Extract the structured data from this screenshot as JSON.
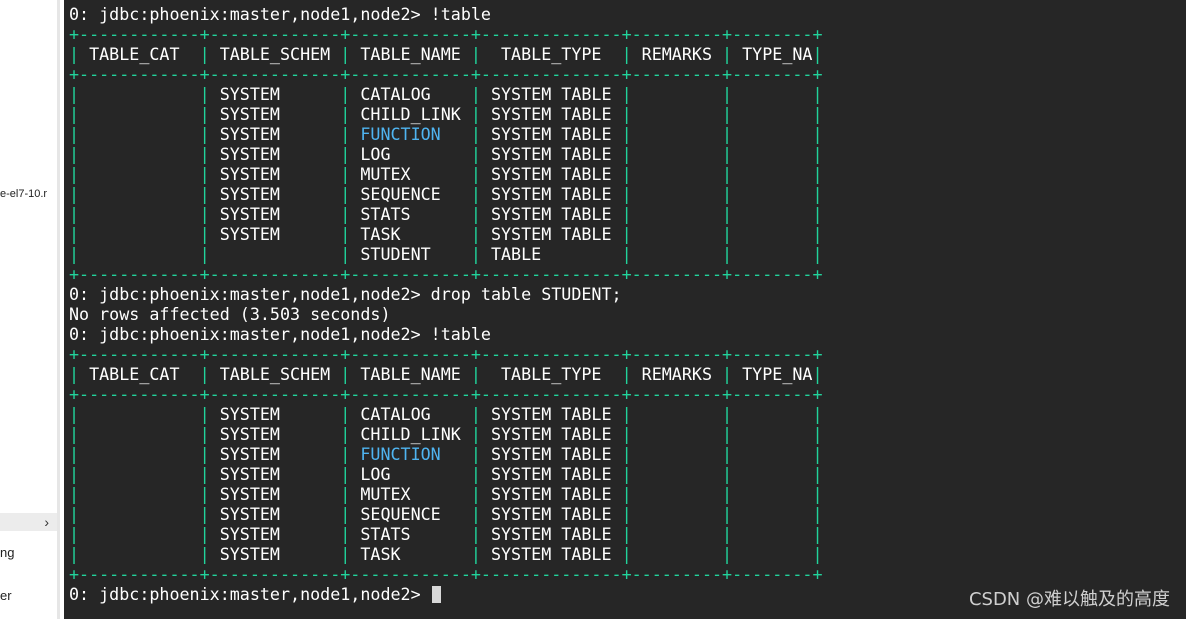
{
  "sidebar": {
    "file_item": "e-el7-10.r",
    "chevron": "›",
    "item_ng": "ng",
    "item_er": "er"
  },
  "terminal": {
    "prompt": "0: jdbc:phoenix:master,node1,node2>",
    "colors": {
      "background": "#262626",
      "text": "#ffffff",
      "border": "#21d39b",
      "highlight": "#4fb4f0"
    },
    "blocks": [
      {
        "type": "command",
        "text": "0: jdbc:phoenix:master,node1,node2> !table"
      },
      {
        "type": "table",
        "id": "table-1",
        "columns": [
          "TABLE_CAT",
          "TABLE_SCHEM",
          "TABLE_NAME",
          "TABLE_TYPE",
          "REMARKS",
          "TYPE_NA"
        ],
        "rows": [
          [
            "",
            "SYSTEM",
            "CATALOG",
            "SYSTEM TABLE",
            "",
            ""
          ],
          [
            "",
            "SYSTEM",
            "CHILD_LINK",
            "SYSTEM TABLE",
            "",
            ""
          ],
          [
            "",
            "SYSTEM",
            "FUNCTION",
            "SYSTEM TABLE",
            "",
            ""
          ],
          [
            "",
            "SYSTEM",
            "LOG",
            "SYSTEM TABLE",
            "",
            ""
          ],
          [
            "",
            "SYSTEM",
            "MUTEX",
            "SYSTEM TABLE",
            "",
            ""
          ],
          [
            "",
            "SYSTEM",
            "SEQUENCE",
            "SYSTEM TABLE",
            "",
            ""
          ],
          [
            "",
            "SYSTEM",
            "STATS",
            "SYSTEM TABLE",
            "",
            ""
          ],
          [
            "",
            "SYSTEM",
            "TASK",
            "SYSTEM TABLE",
            "",
            ""
          ],
          [
            "",
            "",
            "STUDENT",
            "TABLE",
            "",
            ""
          ]
        ]
      },
      {
        "type": "command",
        "text": "0: jdbc:phoenix:master,node1,node2> drop table STUDENT;"
      },
      {
        "type": "output",
        "text": "No rows affected (3.503 seconds)"
      },
      {
        "type": "command",
        "text": "0: jdbc:phoenix:master,node1,node2> !table"
      },
      {
        "type": "table",
        "id": "table-2",
        "columns": [
          "TABLE_CAT",
          "TABLE_SCHEM",
          "TABLE_NAME",
          "TABLE_TYPE",
          "REMARKS",
          "TYPE_NA"
        ],
        "rows": [
          [
            "",
            "SYSTEM",
            "CATALOG",
            "SYSTEM TABLE",
            "",
            ""
          ],
          [
            "",
            "SYSTEM",
            "CHILD_LINK",
            "SYSTEM TABLE",
            "",
            ""
          ],
          [
            "",
            "SYSTEM",
            "FUNCTION",
            "SYSTEM TABLE",
            "",
            ""
          ],
          [
            "",
            "SYSTEM",
            "LOG",
            "SYSTEM TABLE",
            "",
            ""
          ],
          [
            "",
            "SYSTEM",
            "MUTEX",
            "SYSTEM TABLE",
            "",
            ""
          ],
          [
            "",
            "SYSTEM",
            "SEQUENCE",
            "SYSTEM TABLE",
            "",
            ""
          ],
          [
            "",
            "SYSTEM",
            "STATS",
            "SYSTEM TABLE",
            "",
            ""
          ],
          [
            "",
            "SYSTEM",
            "TASK",
            "SYSTEM TABLE",
            "",
            ""
          ]
        ]
      },
      {
        "type": "prompt",
        "text": "0: jdbc:phoenix:master,node1,node2>"
      }
    ],
    "highlight_word": "FUNCTION"
  },
  "watermark": "CSDN @难以触及的高度"
}
